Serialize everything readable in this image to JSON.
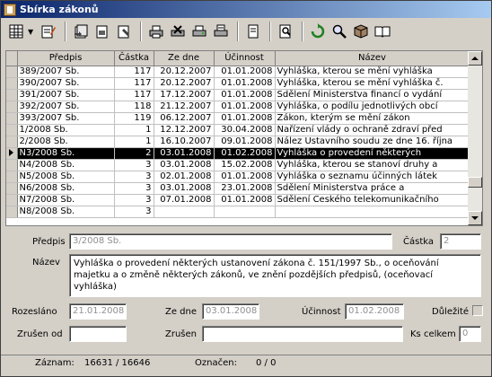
{
  "window": {
    "title": "Sbírka zákonů"
  },
  "grid": {
    "columns": [
      "Předpis",
      "Částka",
      "Ze dne",
      "Účinnost",
      "Název"
    ],
    "rows": [
      [
        "389/2007 Sb.",
        "117",
        "20.12.2007",
        "01.01.2008",
        "Vyhláška, kterou se mění vyhláška"
      ],
      [
        "390/2007 Sb.",
        "117",
        "20.12.2007",
        "01.01.2008",
        "Vyhláška, kterou se mění vyhláška č."
      ],
      [
        "391/2007 Sb.",
        "117",
        "17.12.2007",
        "01.01.2008",
        "Sdělení Ministerstva financí o vydání"
      ],
      [
        "392/2007 Sb.",
        "118",
        "21.12.2007",
        "01.01.2008",
        "Vyhláška, o podílu jednotlivých obcí"
      ],
      [
        "393/2007 Sb.",
        "119",
        "06.12.2007",
        "01.01.2008",
        "Zákon, kterým se mění zákon"
      ],
      [
        "1/2008 Sb.",
        "1",
        "12.12.2007",
        "30.04.2008",
        "Nařízení vlády o ochraně zdraví před"
      ],
      [
        "2/2008 Sb.",
        "1",
        "16.10.2007",
        "09.01.2008",
        "Nález Ústavního soudu ze dne 16. října"
      ],
      [
        "N3/2008 Sb.",
        "2",
        "03.01.2008",
        "01.02.2008",
        "Vyhláška o provedení některých"
      ],
      [
        "N4/2008 Sb.",
        "3",
        "03.01.2008",
        "15.02.2008",
        "Vyhláška, kterou se stanoví druhy a"
      ],
      [
        "N5/2008 Sb.",
        "3",
        "02.01.2008",
        "01.01.2008",
        "Vyhláška o seznamu účinných látek"
      ],
      [
        "N6/2008 Sb.",
        "3",
        "03.01.2008",
        "23.01.2008",
        "Sdělení Ministerstva práce a"
      ],
      [
        "N7/2008 Sb.",
        "3",
        "07.01.2008",
        "01.01.2008",
        "Sdělení Českého telekomunikačního"
      ],
      [
        "N8/2008 Sb.",
        "3",
        "",
        "",
        ""
      ]
    ],
    "selected_index": 7
  },
  "detail": {
    "predpis_label": "Předpis",
    "predpis_value": "3/2008 Sb.",
    "castka_label": "Částka",
    "castka_value": "2",
    "nazev_label": "Název",
    "nazev_value": "Vyhláška o provedení některých ustanovení zákona č. 151/1997 Sb., o oceňování majetku a o změně některých zákonů, ve znění pozdějších předpisů, (oceňovací vyhláška)",
    "rozeslano_label": "Rozesláno",
    "rozeslano_value": "21.01.2008",
    "zedne_label": "Ze dne",
    "zedne_value": "03.01.2008",
    "ucinnost_label": "Účinnost",
    "ucinnost_value": "01.02.2008",
    "dulezite_label": "Důležité",
    "zrusen_od_label": "Zrušen od",
    "zrusen_od_value": "",
    "zrusen_label": "Zrušen",
    "zrusen_value": "",
    "ks_celkem_label": "Ks celkem",
    "ks_celkem_value": "0"
  },
  "status": {
    "zaznam_label": "Záznam:",
    "zaznam_value": "16631 / 16646",
    "oznacen_label": "Označen:",
    "oznacen_value": "0 / 0"
  },
  "toolbar": {
    "icons": [
      "table-menu-icon",
      "dropdown-arrow-icon",
      "edit-icon",
      "doc-icon",
      "doc-copy-icon",
      "doc-add-icon",
      "print-icon",
      "print2-icon",
      "print3-icon",
      "export-icon",
      "archive-icon",
      "find-icon",
      "refresh-icon",
      "search-icon",
      "package-icon",
      "book-icon"
    ]
  },
  "colors": {
    "title_start": "#0a246a",
    "title_end": "#a6caf0",
    "selection": "#000000"
  }
}
